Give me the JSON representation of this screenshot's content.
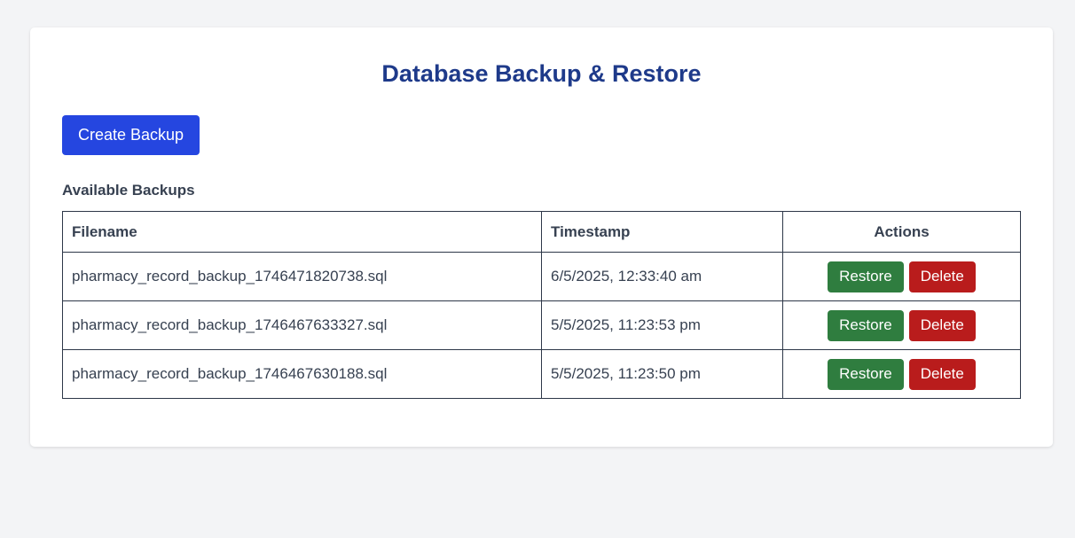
{
  "page": {
    "title": "Database Backup & Restore",
    "create_label": "Create Backup",
    "section_title": "Available Backups"
  },
  "table": {
    "headers": [
      "Filename",
      "Timestamp",
      "Actions"
    ],
    "rows": [
      {
        "filename": "pharmacy_record_backup_1746471820738.sql",
        "timestamp": "6/5/2025, 12:33:40 am",
        "restore": "Restore",
        "delete": "Delete"
      },
      {
        "filename": "pharmacy_record_backup_1746467633327.sql",
        "timestamp": "5/5/2025, 11:23:53 pm",
        "restore": "Restore",
        "delete": "Delete"
      },
      {
        "filename": "pharmacy_record_backup_1746467630188.sql",
        "timestamp": "5/5/2025, 11:23:50 pm",
        "restore": "Restore",
        "delete": "Delete"
      }
    ]
  },
  "colors": {
    "title": "#1e3a8a",
    "primary": "#2546e0",
    "restore": "#2f7d3f",
    "delete": "#b91c1c"
  }
}
